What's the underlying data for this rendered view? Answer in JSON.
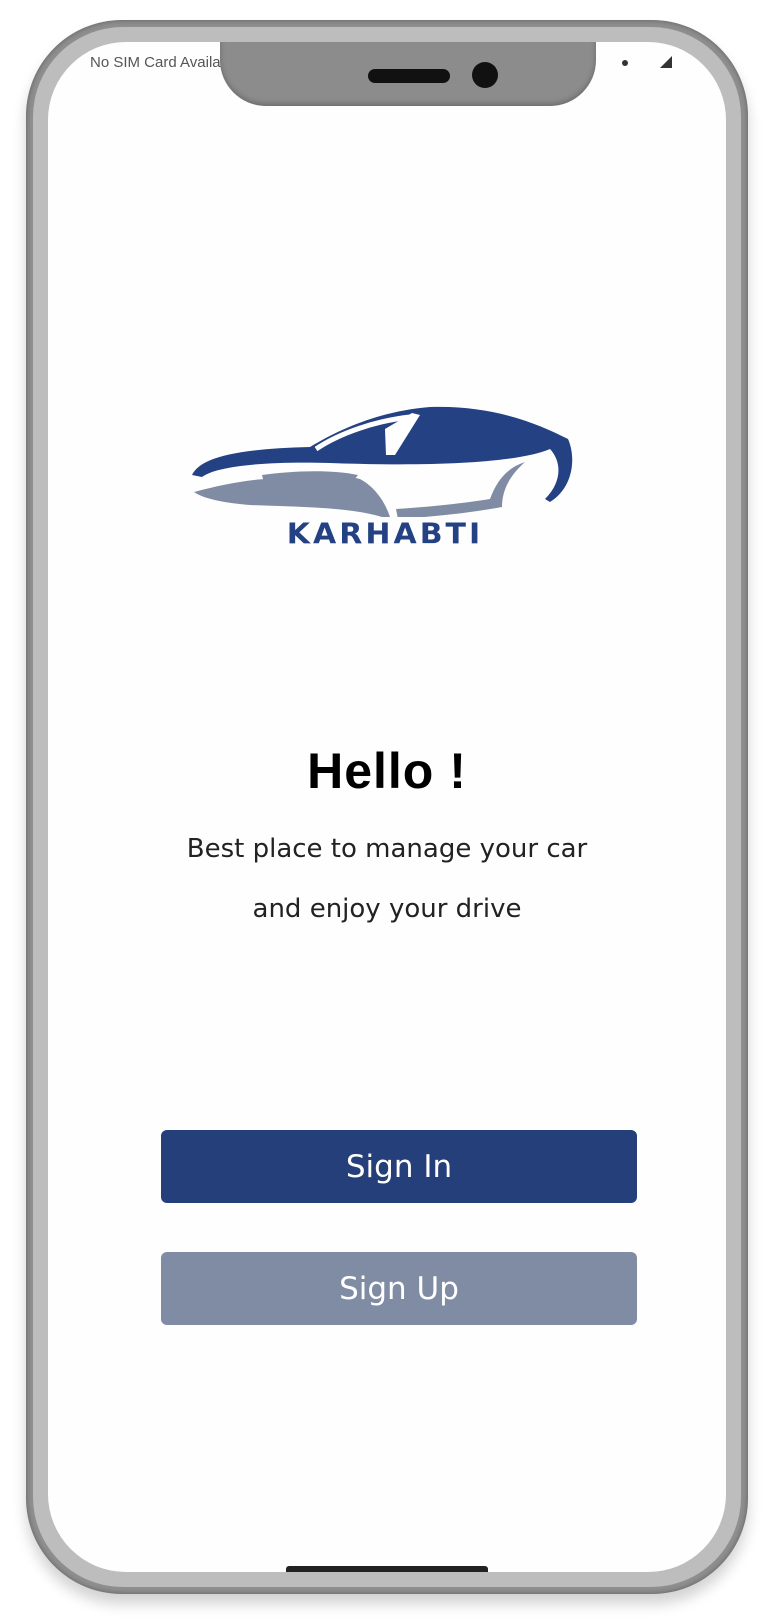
{
  "status_bar": {
    "carrier_text": "No SIM Card Available"
  },
  "brand": {
    "name": "KARHABTI",
    "primary_color": "#244283",
    "secondary_color": "#7f8ca3"
  },
  "welcome": {
    "title": "Hello !",
    "subtitle_line1": "Best place to manage your car",
    "subtitle_line2": "and enjoy your drive"
  },
  "actions": {
    "sign_in_label": "Sign In",
    "sign_up_label": "Sign Up"
  }
}
